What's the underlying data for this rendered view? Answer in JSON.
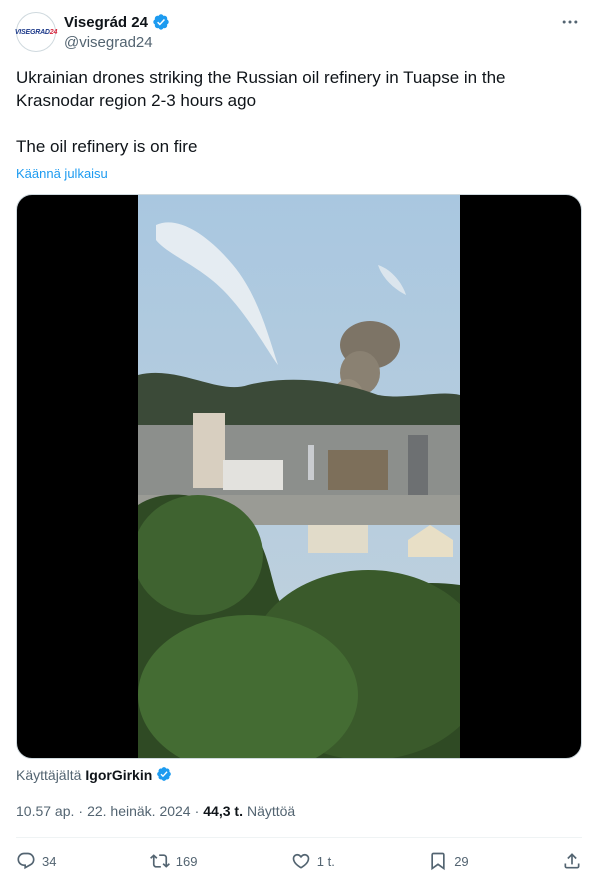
{
  "author": {
    "display_name": "Visegrád 24",
    "handle": "@visegrad24",
    "avatar_text_a": "VISEGRAD",
    "avatar_text_b": "24"
  },
  "tweet": {
    "text": "Ukrainian drones striking the Russian oil refinery in Tuapse in the Krasnodar region 2-3 hours ago\n\nThe oil refinery is on fire",
    "translate_label": "Käännä julkaisu"
  },
  "source": {
    "label": "Käyttäjältä",
    "user": "IgorGirkin"
  },
  "meta": {
    "time": "10.57 ap.",
    "separator1": "·",
    "date": "22. heinäk. 2024",
    "separator2": "·",
    "views_count": "44,3 t.",
    "views_label": "Näyttöä"
  },
  "actions": {
    "replies": "34",
    "reposts": "169",
    "likes": "1 t.",
    "bookmarks": "29"
  },
  "colors": {
    "accent": "#1d9bf0",
    "text": "#0f1419",
    "muted": "#536471",
    "repost": "#00ba7c"
  },
  "icons": [
    "verified-badge-icon",
    "more-icon",
    "reply-icon",
    "repost-icon",
    "like-icon",
    "bookmark-icon",
    "share-icon"
  ]
}
